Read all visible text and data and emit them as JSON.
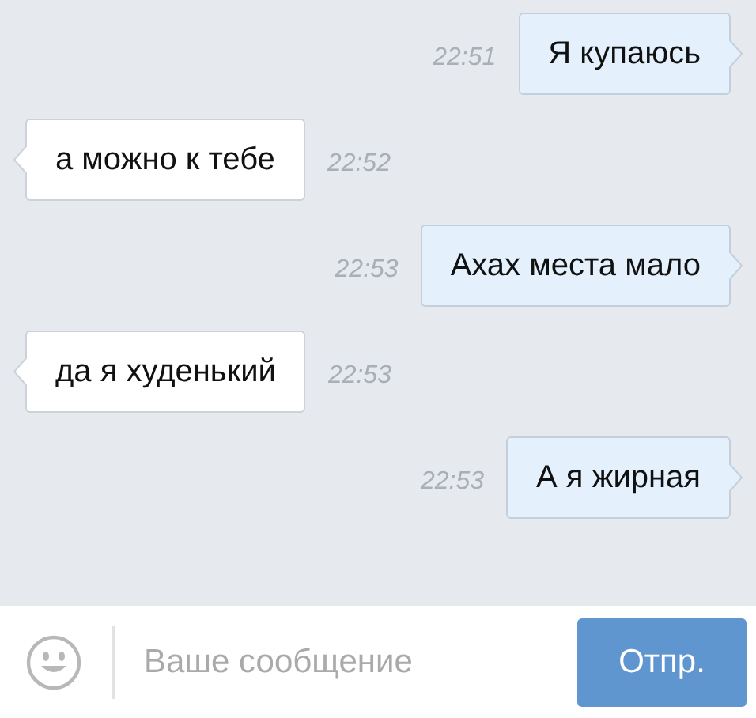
{
  "messages": [
    {
      "kind": "outgoing",
      "text": "Я купаюсь",
      "time": "22:51"
    },
    {
      "kind": "incoming",
      "text": "а можно к тебе",
      "time": "22:52"
    },
    {
      "kind": "outgoing",
      "text": "Ахах места мало",
      "time": "22:53"
    },
    {
      "kind": "incoming",
      "text": "да я худенький",
      "time": "22:53"
    },
    {
      "kind": "outgoing",
      "text": "А я жирная",
      "time": "22:53"
    }
  ],
  "composer": {
    "placeholder": "Ваше сообщение",
    "send_button": "Отпр."
  }
}
